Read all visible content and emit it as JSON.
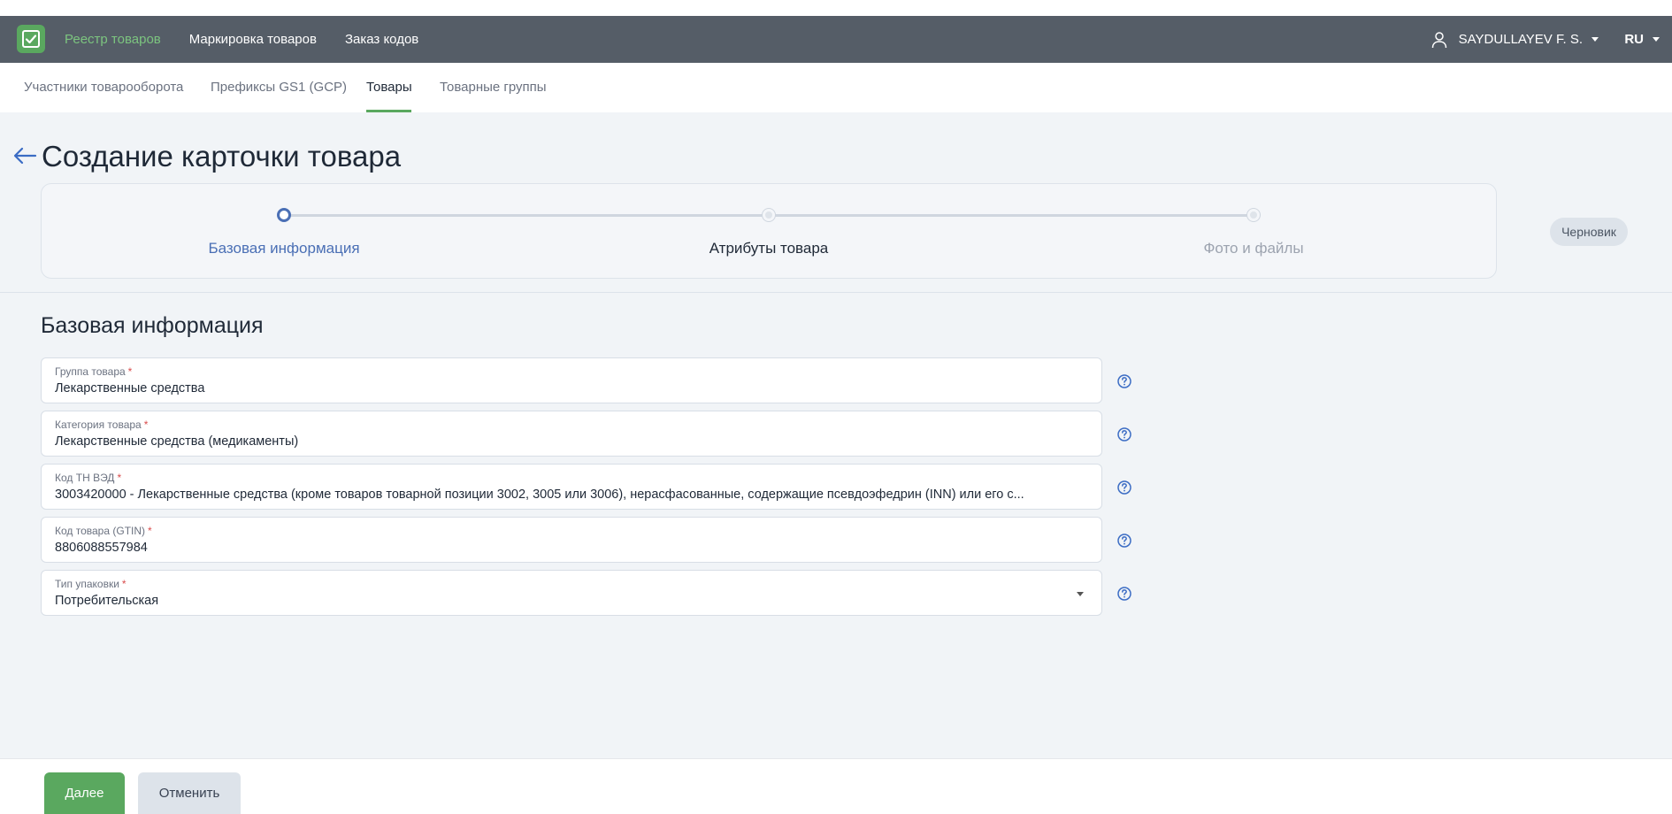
{
  "header": {
    "nav": [
      "Реестр товаров",
      "Маркировка товаров",
      "Заказ кодов"
    ],
    "user": "SAYDULLAYEV F. S.",
    "lang": "RU"
  },
  "subnav": [
    "Участники товарооборота",
    "Префиксы GS1 (GCP)",
    "Товары",
    "Товарные группы"
  ],
  "page": {
    "title": "Создание карточки товара",
    "status": "Черновик"
  },
  "steps": [
    "Базовая информация",
    "Атрибуты товара",
    "Фото и файлы"
  ],
  "section": {
    "title": "Базовая информация"
  },
  "fields": [
    {
      "label": "Группа товара",
      "value": "Лекарственные средства"
    },
    {
      "label": "Категория товара",
      "value": "Лекарственные средства (медикаменты)"
    },
    {
      "label": "Код ТН ВЭД",
      "value": "3003420000 - Лекарственные средства (кроме товаров товарной позиции 3002, 3005 или 3006), нерасфасованные, содержащие псевдоэфедрин (INN) или его с..."
    },
    {
      "label": "Код товара (GTIN)",
      "value": "8806088557984"
    },
    {
      "label": "Тип упаковки",
      "value": "Потребительская"
    }
  ],
  "required_mark": "*",
  "buttons": {
    "next": "Далее",
    "cancel": "Отменить"
  },
  "colors": {
    "brand_green": "#5aa85f",
    "header_bg": "#555d67",
    "step_active": "#4a6fb5"
  },
  "icons": [
    "logo-icon",
    "user-icon",
    "back-arrow-icon",
    "help-icon",
    "dropdown-caret-icon"
  ]
}
